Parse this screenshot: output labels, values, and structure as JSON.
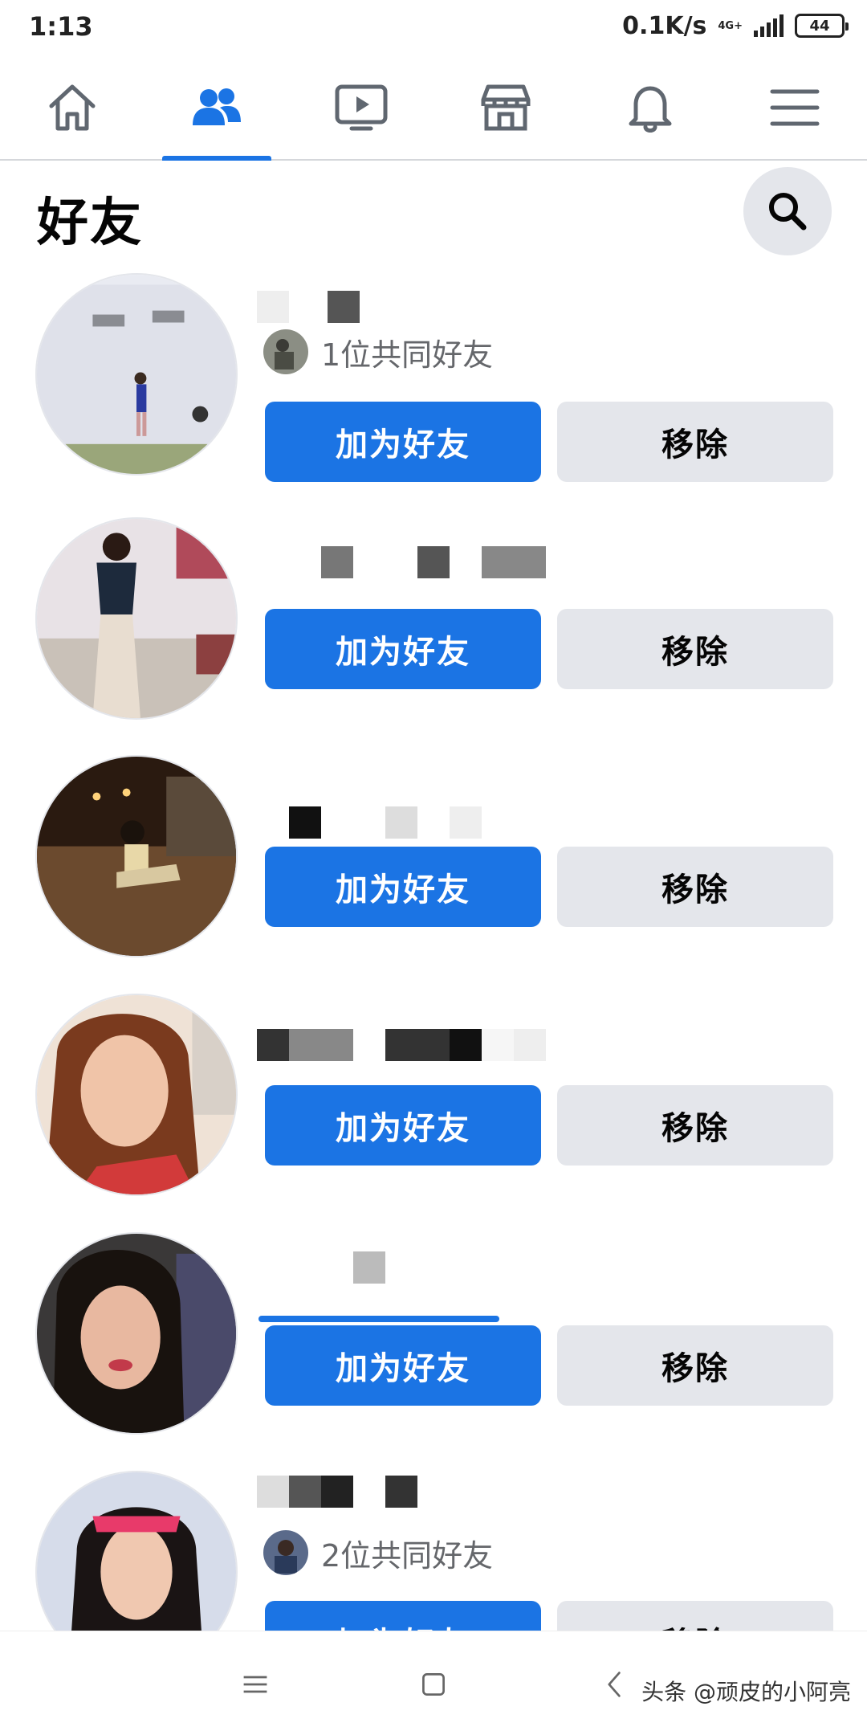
{
  "status_bar": {
    "time": "1:13",
    "net_speed": "0.1K/s",
    "net_type": "4G+",
    "battery": "44"
  },
  "nav": {
    "tabs": [
      {
        "name": "home-icon",
        "active": false
      },
      {
        "name": "friends-icon",
        "active": true
      },
      {
        "name": "watch-icon",
        "active": false
      },
      {
        "name": "marketplace-icon",
        "active": false
      },
      {
        "name": "notifications-icon",
        "active": false
      },
      {
        "name": "menu-icon",
        "active": false
      }
    ],
    "accent": "#1b74e4"
  },
  "header": {
    "title": "好友"
  },
  "requests": [
    {
      "mutual": "1位共同好友",
      "add_label": "加为好友",
      "remove_label": "移除"
    },
    {
      "mutual": "",
      "add_label": "加为好友",
      "remove_label": "移除"
    },
    {
      "mutual": "",
      "add_label": "加为好友",
      "remove_label": "移除"
    },
    {
      "mutual": "",
      "add_label": "加为好友",
      "remove_label": "移除"
    },
    {
      "mutual": "",
      "add_label": "加为好友",
      "remove_label": "移除"
    },
    {
      "mutual": "2位共同好友",
      "add_label": "加为好友",
      "remove_label": "移除"
    }
  ],
  "watermark": "头条 @顽皮的小阿亮"
}
